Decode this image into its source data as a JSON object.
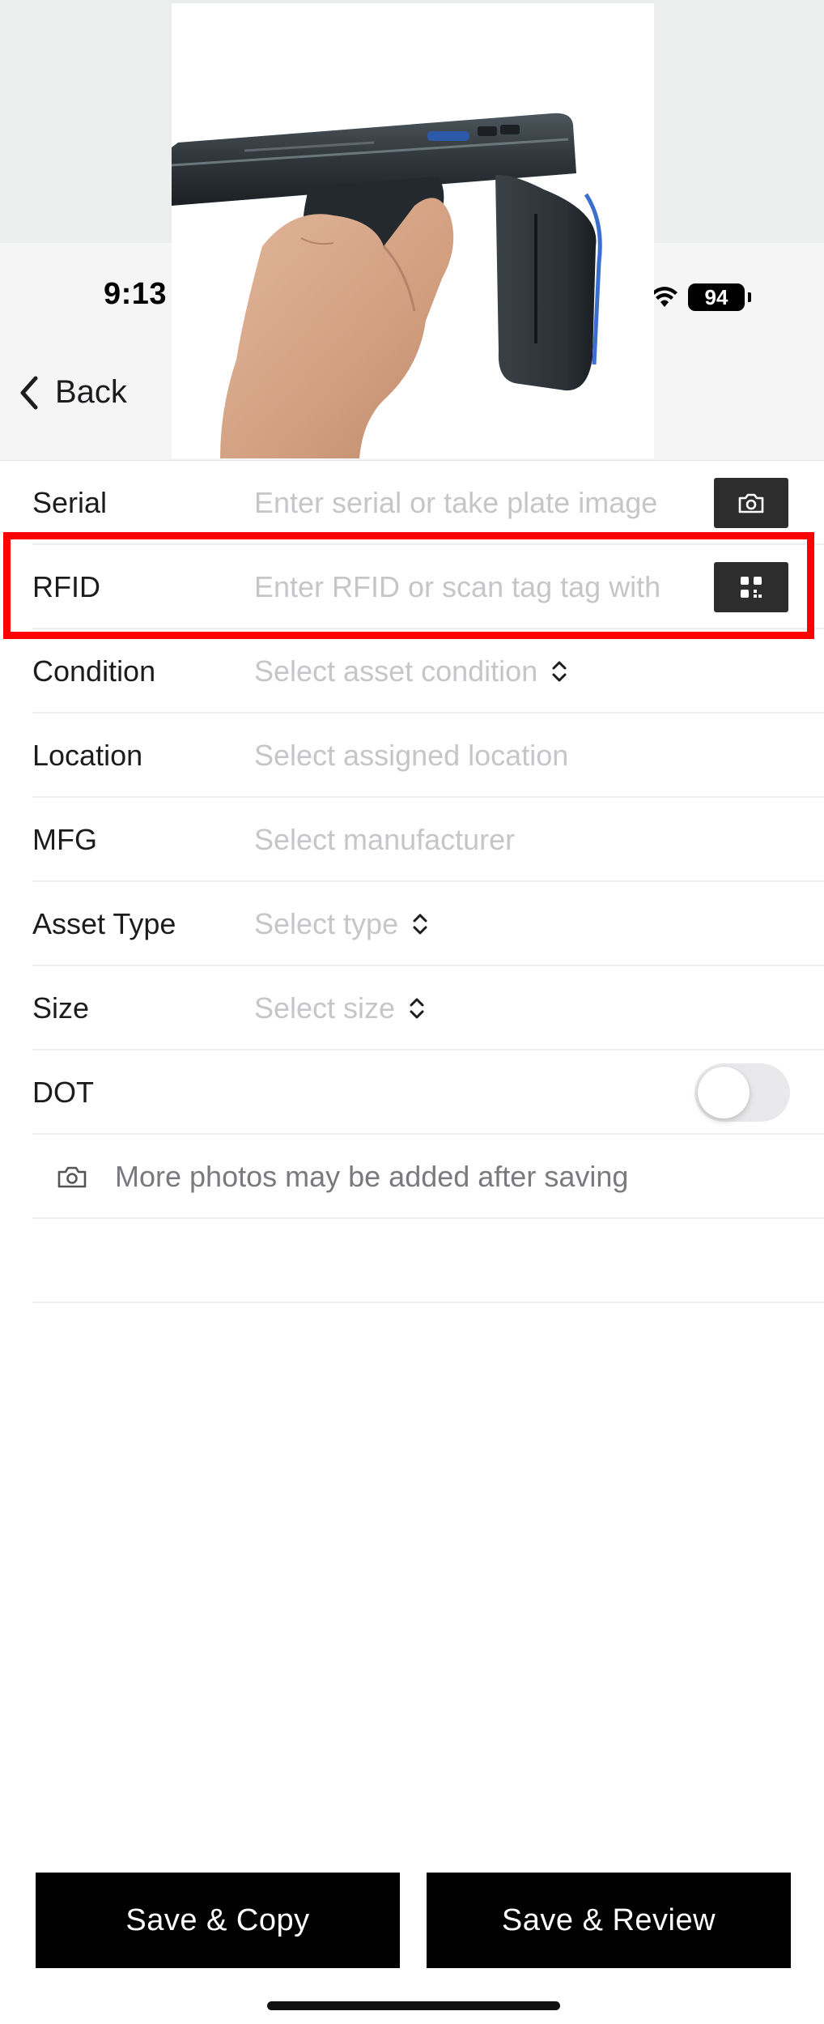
{
  "status_bar": {
    "time": "9:13",
    "battery": "94"
  },
  "nav": {
    "back_label": "Back"
  },
  "form": {
    "serial": {
      "label": "Serial",
      "placeholder": "Enter serial or take plate image"
    },
    "rfid": {
      "label": "RFID",
      "placeholder": "Enter RFID or scan tag tag with"
    },
    "condition": {
      "label": "Condition",
      "value": "Select asset condition"
    },
    "location": {
      "label": "Location",
      "value": "Select assigned location"
    },
    "mfg": {
      "label": "MFG",
      "value": "Select manufacturer"
    },
    "asset_type": {
      "label": "Asset Type",
      "value": "Select type"
    },
    "size": {
      "label": "Size",
      "value": "Select size"
    },
    "dot": {
      "label": "DOT",
      "enabled": false
    },
    "photos_note": "More photos may be added after saving"
  },
  "actions": {
    "save_copy": "Save & Copy",
    "save_review": "Save & Review"
  },
  "icons": {
    "serial_action": "camera-icon",
    "rfid_action": "qr-scan-icon",
    "note": "camera-icon",
    "select": "chevron-up-down-icon"
  },
  "colors": {
    "highlight": "#ff0000",
    "button_bg": "#000000",
    "placeholder": "#c6c6c9"
  }
}
